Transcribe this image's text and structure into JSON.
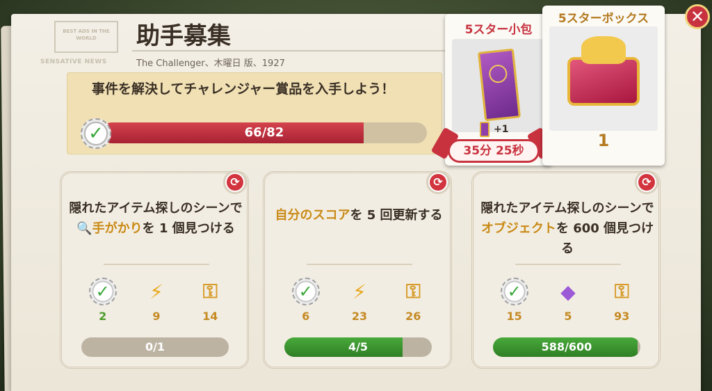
{
  "header": {
    "masthead_text": "BEST ADS\nIN THE WORLD",
    "masthead_sub": "SENSATIVE NEWS",
    "title": "助手募集",
    "subtitle": "The Challenger、木曜日 版、1927"
  },
  "challenge": {
    "text": "事件を解決してチャレンジャー賞品を入手しよう！",
    "progress_label": "66/82",
    "progress_value": 66,
    "progress_max": 82
  },
  "rewards_cards": {
    "small": {
      "title": "5スター小包",
      "bonus": "+1",
      "timer": "35分 25秒"
    },
    "big": {
      "title": "5スターボックス",
      "count": "1"
    }
  },
  "close_label": "✕",
  "tasks": [
    {
      "text_parts": [
        "隠れたアイテム探しのシーンで",
        "手がかり",
        "を 1 個見つける"
      ],
      "rewards": [
        {
          "icon": "check-plus-icon",
          "value": "2"
        },
        {
          "icon": "lightning-icon",
          "value": "9"
        },
        {
          "icon": "key-icon",
          "value": "14"
        }
      ],
      "progress_label": "0/1",
      "progress_value": 0,
      "progress_max": 1
    },
    {
      "text_parts": [
        "",
        "自分のスコア",
        "を 5 回更新する"
      ],
      "rewards": [
        {
          "icon": "check-icon",
          "value": "6"
        },
        {
          "icon": "lightning-icon",
          "value": "23"
        },
        {
          "icon": "key-icon",
          "value": "26"
        }
      ],
      "progress_label": "4/5",
      "progress_value": 4,
      "progress_max": 5
    },
    {
      "text_parts": [
        "隠れたアイテム探しのシーンで",
        "オブジェクト",
        "を 600 個見つける"
      ],
      "rewards": [
        {
          "icon": "check-icon",
          "value": "15"
        },
        {
          "icon": "gem-icon",
          "value": "5"
        },
        {
          "icon": "key-icon",
          "value": "93"
        }
      ],
      "progress_label": "588/600",
      "progress_value": 588,
      "progress_max": 600
    }
  ],
  "colors": {
    "accent_red": "#c8323f",
    "gold": "#c98a16",
    "progress_green": "#48a93a"
  }
}
